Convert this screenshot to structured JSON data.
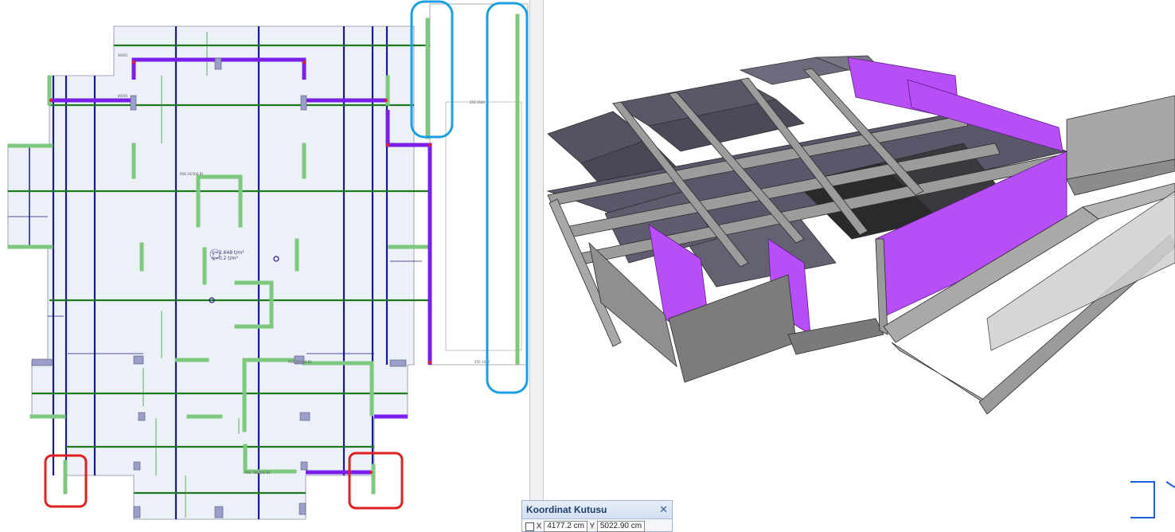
{
  "plan": {
    "slab_load_g": "g=2.648 t/m²",
    "slab_load_q": "q=0.2 t/m²",
    "wall_tag": "PDE 20/300 B1",
    "column_tag": "S0001",
    "beam_tag": "K0001",
    "dimension_tag": "250 1040",
    "bottom_tag": "P02 780/200 B1"
  },
  "colors": {
    "slab_fill": "#ecf1f8",
    "beam_purple": "#7a1fe8",
    "axis_navy": "#1a1a8c",
    "axis_green": "#1f7a1f",
    "wall_green": "#7fc87f",
    "highlight_blue": "#1aa0e0",
    "highlight_red": "#e02020",
    "shear_wall_3d": "#b84ef5"
  },
  "coord_box": {
    "title": "Koordinat Kutusu",
    "x_label": "X",
    "x_value": "4177.2 cm",
    "y_label": "Y",
    "y_value": "5022.90 cm"
  }
}
